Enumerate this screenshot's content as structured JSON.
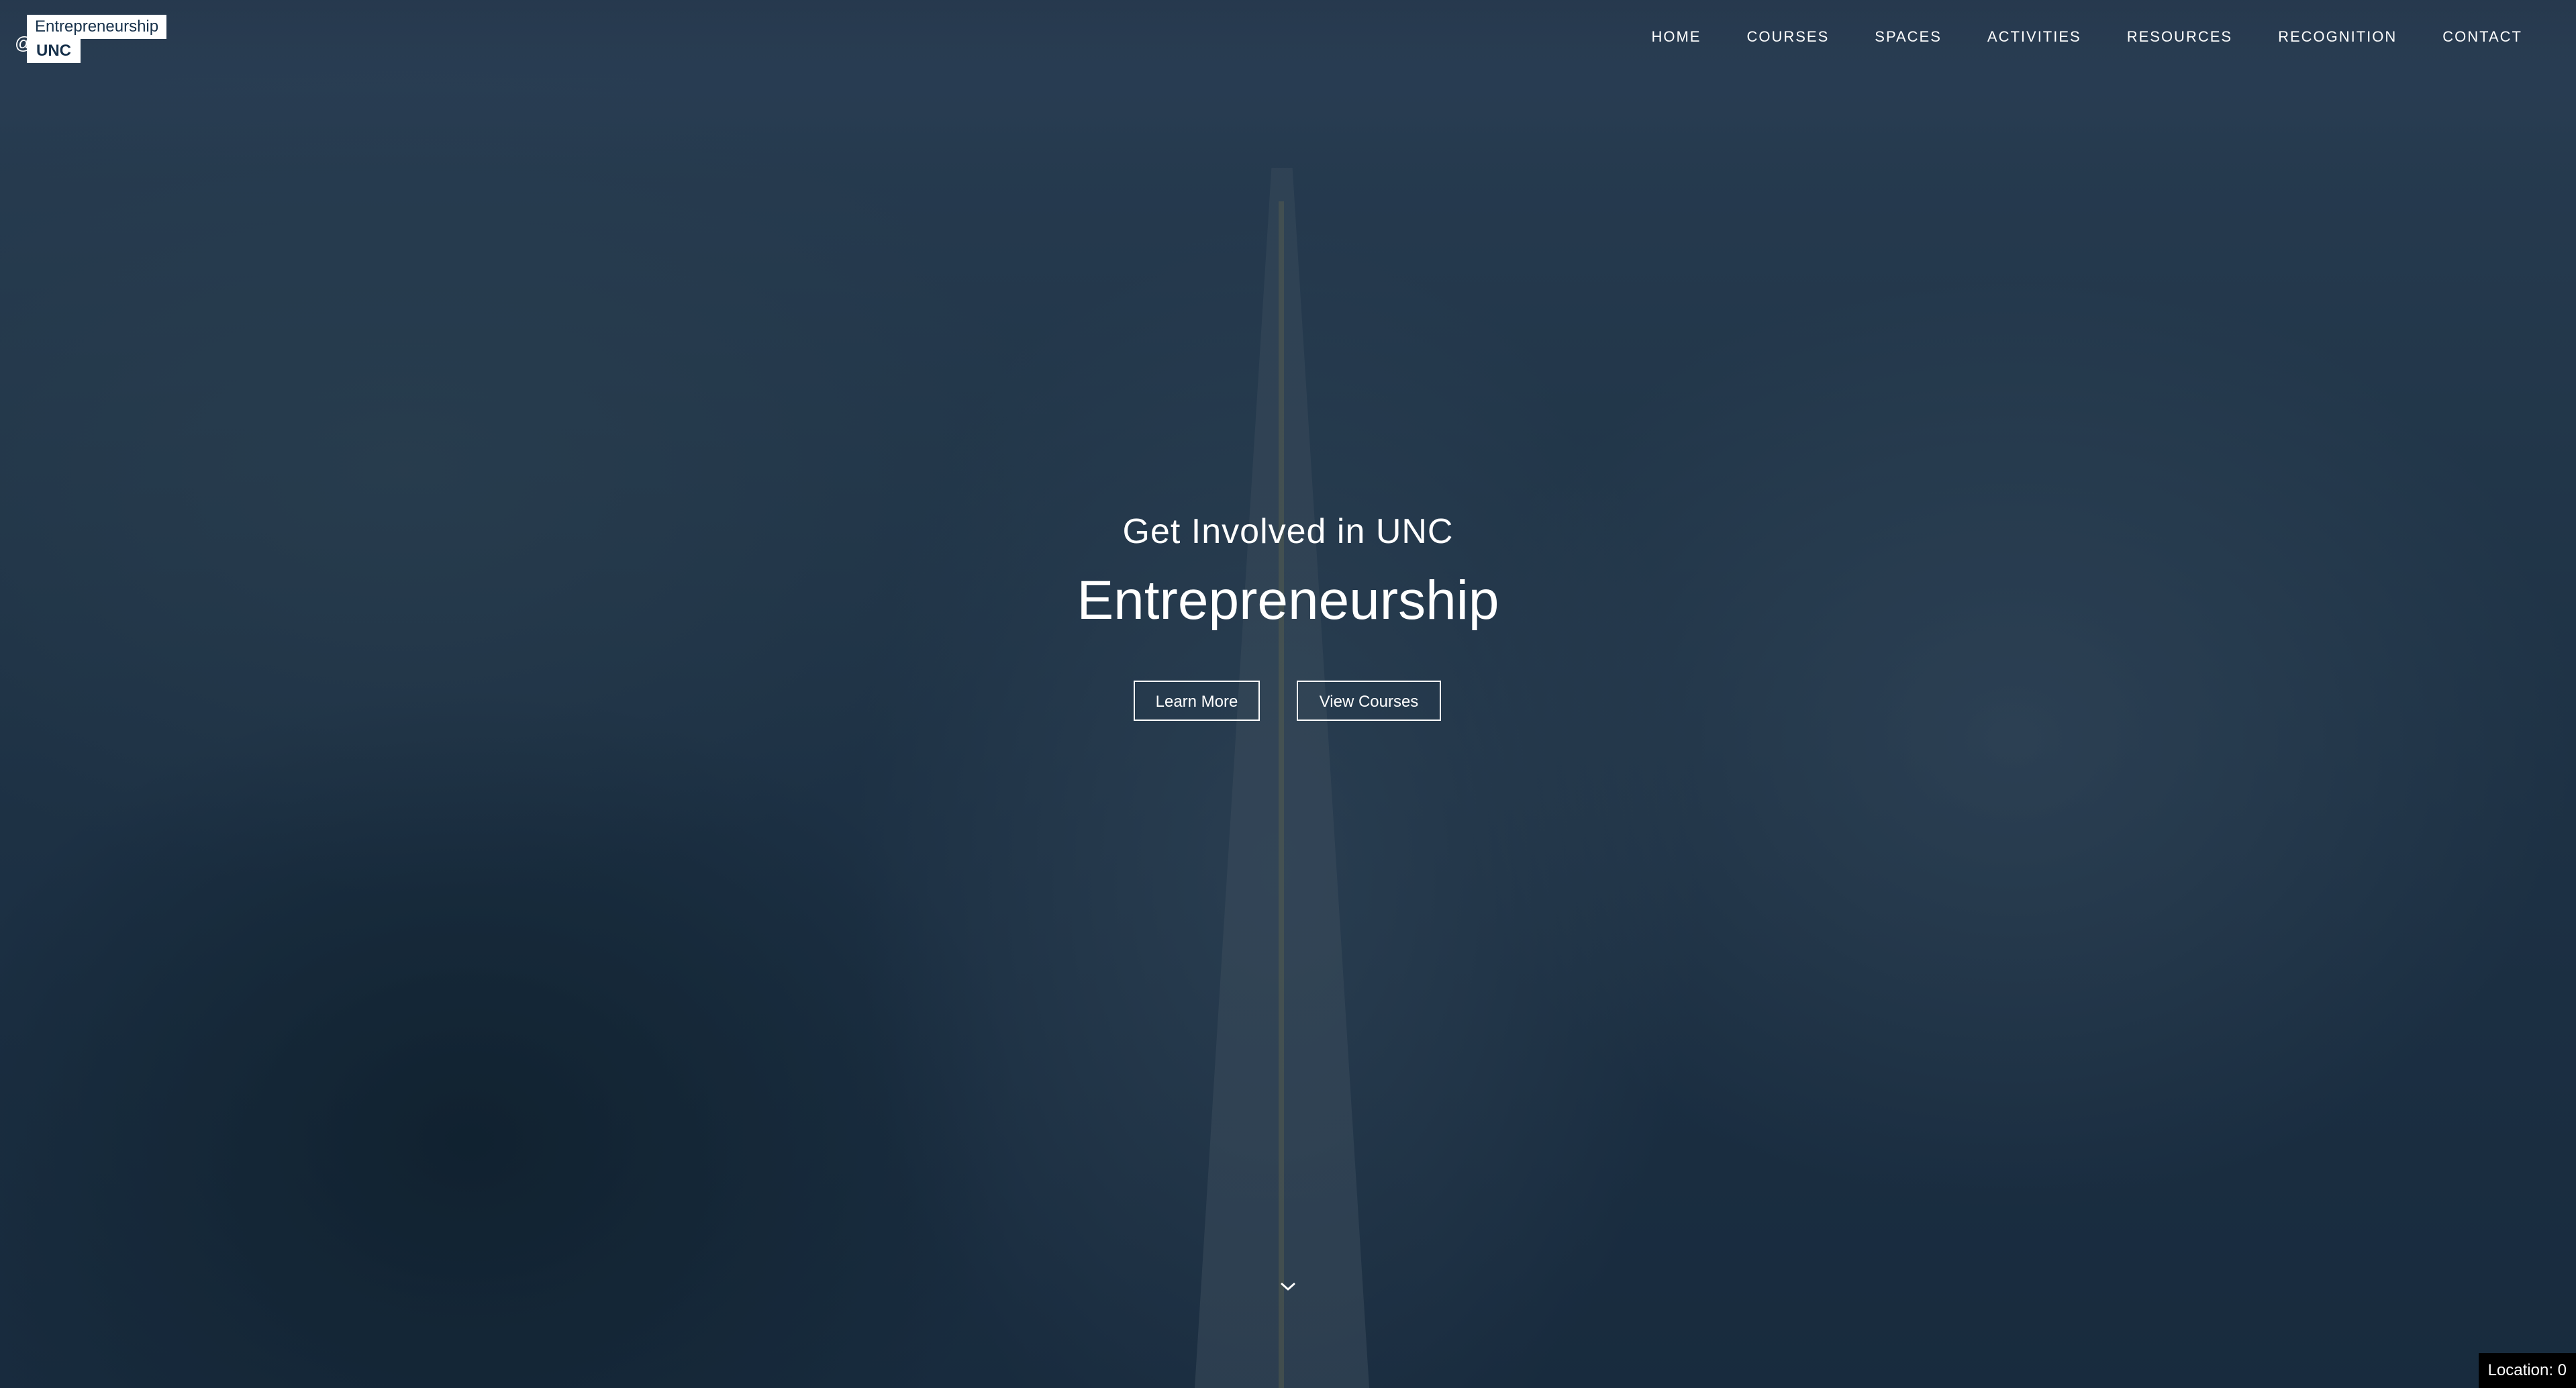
{
  "logo": {
    "at_symbol": "@",
    "top_text": "Entrepreneurship",
    "bottom_text": "UNC"
  },
  "nav": {
    "items": [
      {
        "label": "HOME"
      },
      {
        "label": "COURSES"
      },
      {
        "label": "SPACES"
      },
      {
        "label": "ACTIVITIES"
      },
      {
        "label": "RESOURCES"
      },
      {
        "label": "RECOGNITION"
      },
      {
        "label": "CONTACT"
      }
    ]
  },
  "hero": {
    "subtitle": "Get Involved in UNC",
    "title": "Entrepreneurship",
    "buttons": {
      "learn_more": "Learn More",
      "view_courses": "View Courses"
    },
    "scroll_icon": "chevron-down-icon"
  },
  "status": {
    "location": "Location: 0"
  },
  "colors": {
    "overlay": "#1e3550",
    "text": "#ffffff",
    "logo_text": "#16304a"
  }
}
